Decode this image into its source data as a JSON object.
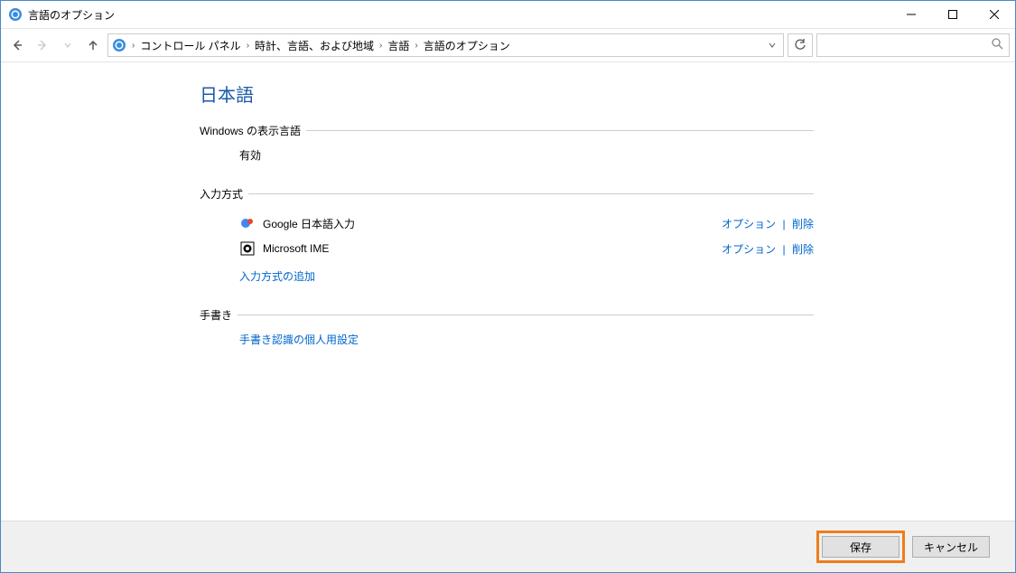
{
  "window": {
    "title": "言語のオプション"
  },
  "breadcrumb": {
    "items": [
      "コントロール パネル",
      "時計、言語、および地域",
      "言語",
      "言語のオプション"
    ]
  },
  "search": {
    "placeholder": ""
  },
  "page": {
    "title": "日本語"
  },
  "groups": {
    "display_language": {
      "label": "Windows の表示言語",
      "value": "有効"
    },
    "input_method": {
      "label": "入力方式",
      "items": [
        {
          "name": "Google 日本語入力",
          "option_label": "オプション",
          "remove_label": "削除"
        },
        {
          "name": "Microsoft IME",
          "option_label": "オプション",
          "remove_label": "削除"
        }
      ],
      "add_link": "入力方式の追加"
    },
    "handwriting": {
      "label": "手書き",
      "personalize_link": "手書き認識の個人用設定"
    }
  },
  "footer": {
    "save": "保存",
    "cancel": "キャンセル"
  }
}
